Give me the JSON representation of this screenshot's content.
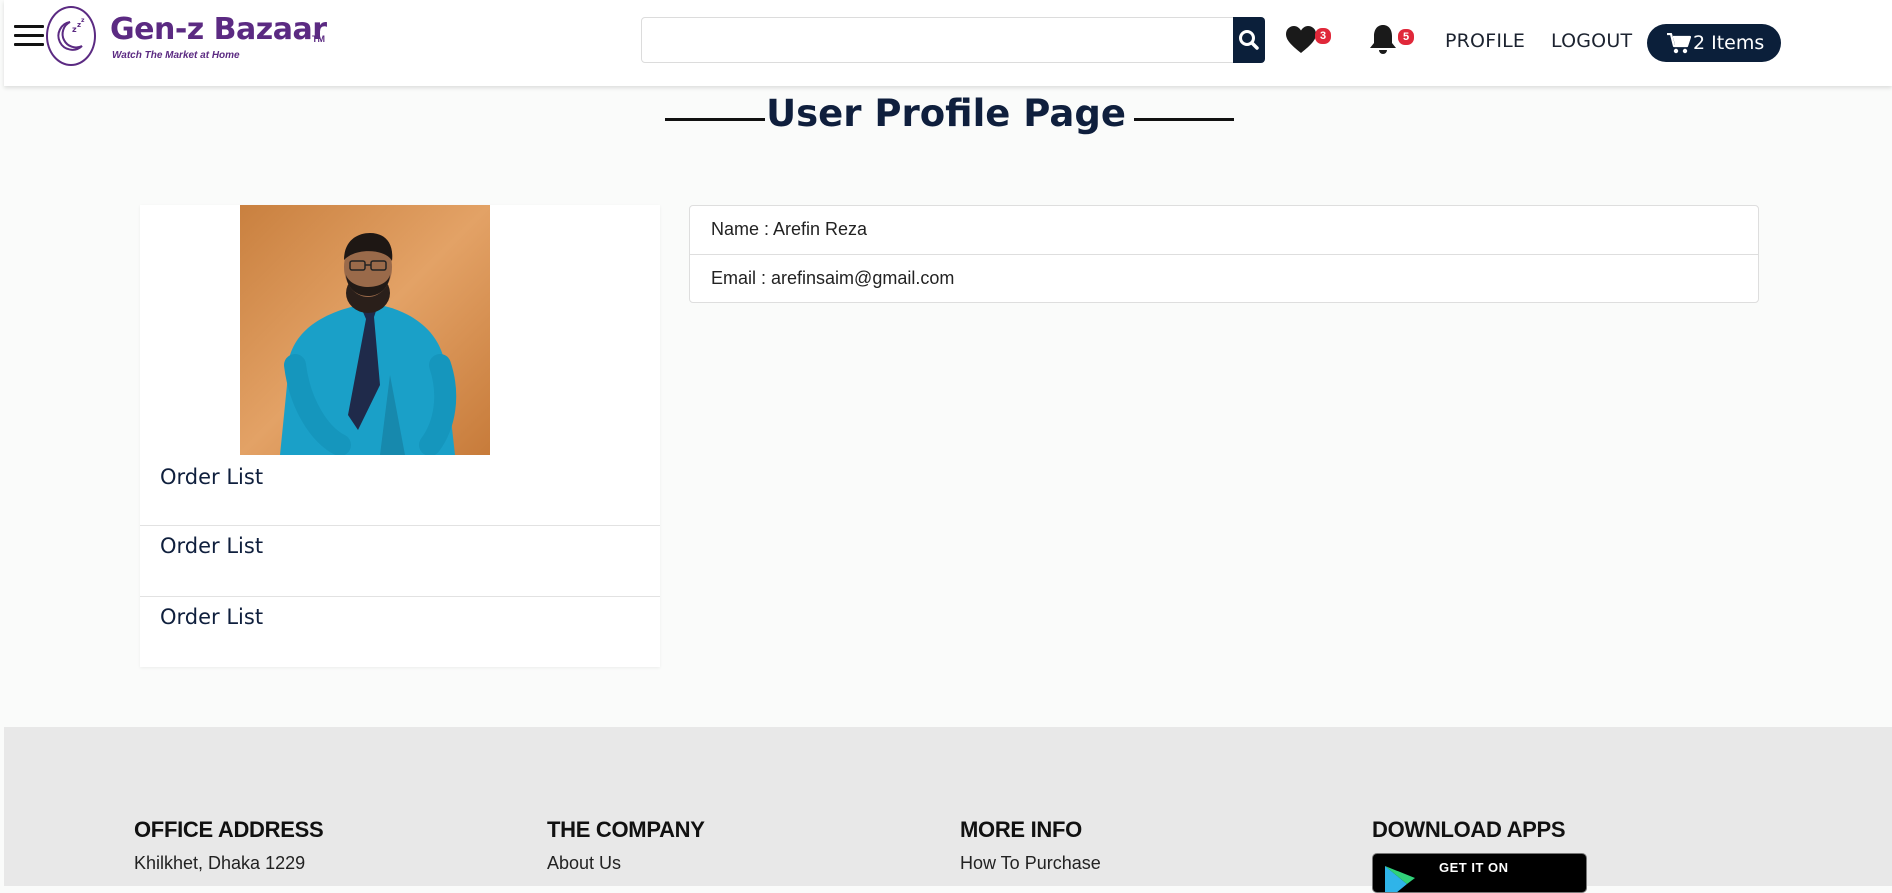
{
  "brand": {
    "name": "Gen-z Bazaar",
    "tm": "TM",
    "tagline": "Watch The Market at Home",
    "color": "#5b2a82"
  },
  "header": {
    "menu_icon": "hamburger-icon",
    "search": {
      "value": "",
      "placeholder": "",
      "icon": "search-icon"
    },
    "wishlist": {
      "icon": "heart-icon",
      "count": "3"
    },
    "notifications": {
      "icon": "bell-icon",
      "count": "5"
    },
    "profile_label": "PROFILE",
    "logout_label": "LOGOUT",
    "cart": {
      "icon": "cart-icon",
      "label": "2 Items"
    }
  },
  "page": {
    "title": "User Profile Page"
  },
  "profile": {
    "avatar_alt": "user-photo",
    "menu": [
      {
        "label": "Order List"
      },
      {
        "label": "Order List"
      },
      {
        "label": "Order List"
      }
    ],
    "details": [
      {
        "text": "Name : Arefin Reza"
      },
      {
        "text": "Email : arefinsaim@gmail.com"
      }
    ]
  },
  "footer": {
    "columns": [
      {
        "heading": "OFFICE ADDRESS",
        "text": "Khilkhet, Dhaka 1229"
      },
      {
        "heading": "THE COMPANY",
        "text": "About Us"
      },
      {
        "heading": "MORE INFO",
        "text": "How To Purchase"
      },
      {
        "heading": "DOWNLOAD APPS",
        "badge": "GET IT ON"
      }
    ]
  },
  "colors": {
    "primary_dark": "#0b1f3a",
    "badge_red": "#e0283a",
    "brand_purple": "#5b2a82",
    "footer_bg": "#e8e8e8"
  }
}
